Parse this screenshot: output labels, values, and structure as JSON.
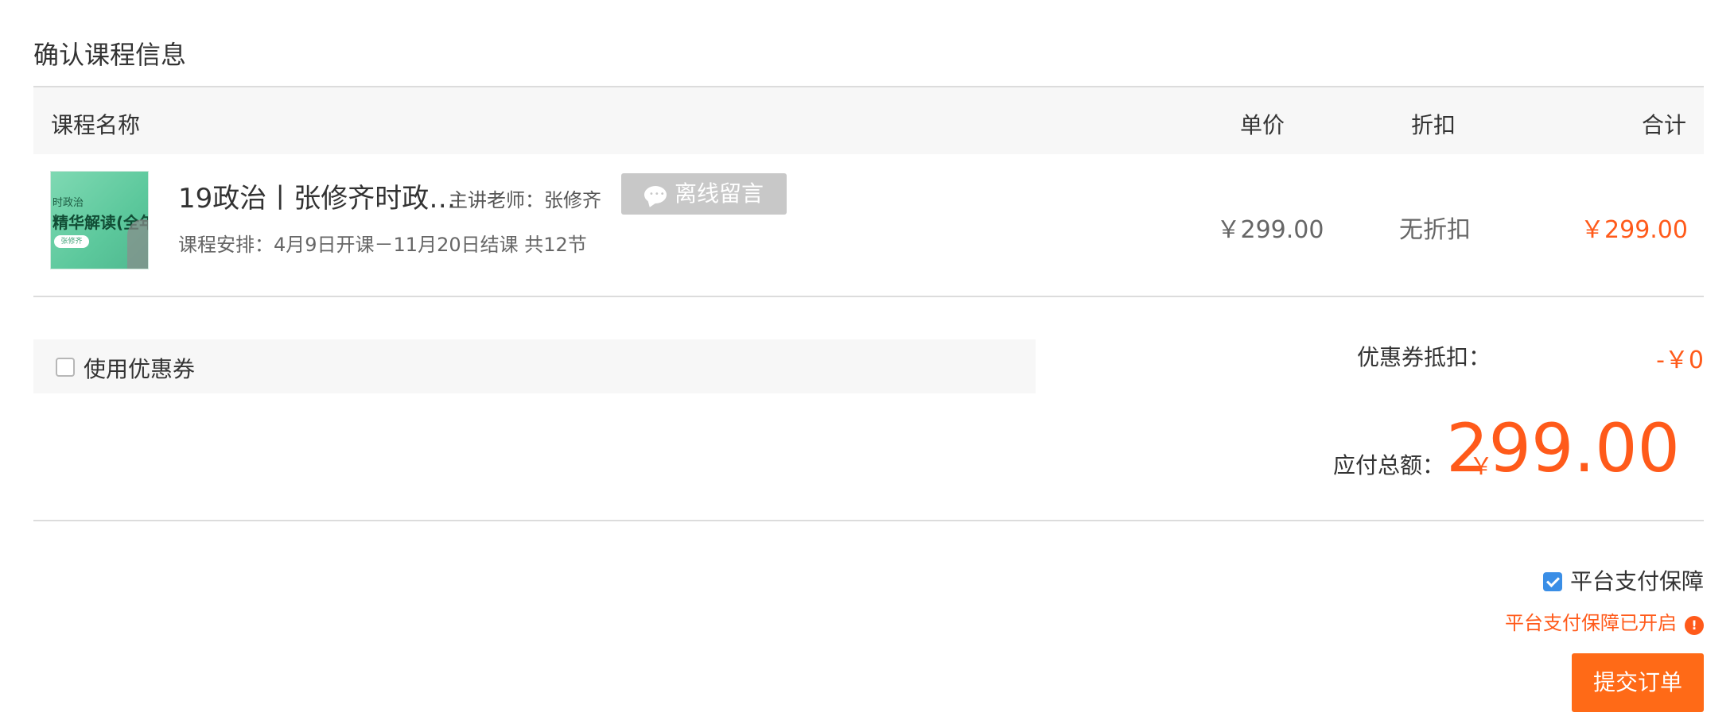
{
  "section_title": "确认课程信息",
  "table": {
    "headers": {
      "name": "课程名称",
      "price": "单价",
      "discount": "折扣",
      "total": "合计"
    },
    "row": {
      "thumbnail": {
        "line1": "时政治",
        "line2": "精华解读(全年)",
        "badge": "张修齐"
      },
      "title": "19政治丨张修齐时政…",
      "teacher": "主讲老师：张修齐",
      "message_button": "离线留言",
      "schedule": "课程安排：4月9日开课－11月20日结课 共12节",
      "price": "￥299.00",
      "discount": "无折扣",
      "total": "￥299.00"
    }
  },
  "coupon": {
    "checkbox_label": "使用优惠券",
    "checked": false,
    "deduct_label": "优惠券抵扣：",
    "deduct_value": "-￥0"
  },
  "payable": {
    "label": "应付总额：",
    "currency": "￥",
    "amount": "299.00"
  },
  "guarantee": {
    "label": "平台支付保障",
    "checked": true,
    "note": "平台支付保障已开启",
    "alert_icon": "!"
  },
  "submit_button": "提交订单",
  "colors": {
    "accent": "#ff5a1a",
    "button": "#ff6a17",
    "checkbox_blue": "#3a8ee6",
    "header_bg": "#f7f7f7"
  }
}
